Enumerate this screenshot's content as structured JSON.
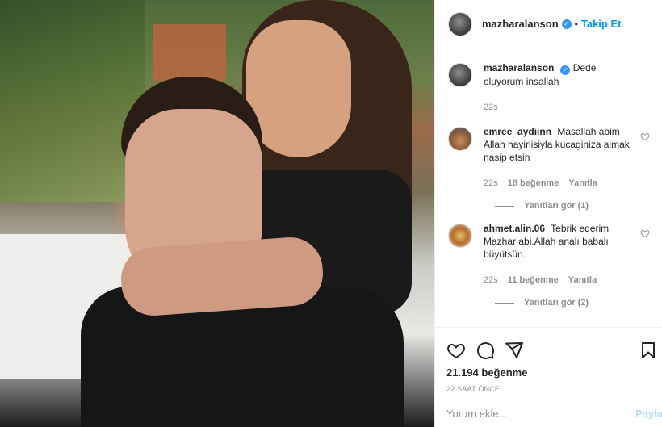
{
  "header": {
    "username": "mazharalanson",
    "dot": "•",
    "follow_label": "Takip Et"
  },
  "caption": {
    "username": "mazharalanson",
    "text": "Dede oluyorum insallah",
    "time": "22s"
  },
  "comments": [
    {
      "username": "emree_aydiinn",
      "text": "Masallah abim Allah hayirlisiyla kucaginiza almak nasip etsin",
      "time": "22s",
      "likes": "18 beğenme",
      "reply": "Yanıtla",
      "view_replies": "Yanıtları gör (1)"
    },
    {
      "username": "ahmet.alin.06",
      "text": "Tebrik ederim Mazhar abi.Allah analı babalı büyütsün.",
      "time": "22s",
      "likes": "11 beğenme",
      "reply": "Yanıtla",
      "view_replies": "Yanıtları gör (2)"
    }
  ],
  "post": {
    "likes": "21.194 beğenme",
    "posted": "22 SAAT ÖNCE"
  },
  "add_comment": {
    "placeholder": "Yorum ekle...",
    "post_label": "Payla"
  }
}
